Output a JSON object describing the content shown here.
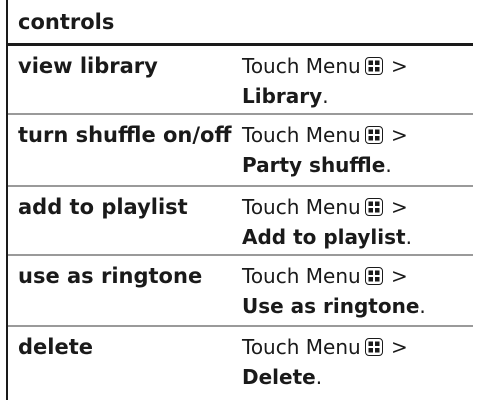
{
  "table": {
    "header": "controls",
    "rows": [
      {
        "term": "view library",
        "touch": "Touch Menu",
        "gt": ">",
        "target": "Library",
        "end": "."
      },
      {
        "term": "turn shuffle on/off",
        "touch": "Touch Menu",
        "gt": ">",
        "target": "Party shuffle",
        "end": "."
      },
      {
        "term": "add to playlist",
        "touch": "Touch Menu",
        "gt": ">",
        "target": "Add to playlist",
        "end": "."
      },
      {
        "term": "use as ringtone",
        "touch": "Touch Menu",
        "gt": ">",
        "target": "Use as ringtone",
        "end": "."
      },
      {
        "term": "delete",
        "touch": "Touch Menu",
        "gt": ">",
        "target": "Delete",
        "end": "."
      }
    ]
  },
  "icons": {
    "menu": "menu-key-icon"
  },
  "colors": {
    "text": "#1a1a1a",
    "row_divider": "#9a9a9a"
  }
}
